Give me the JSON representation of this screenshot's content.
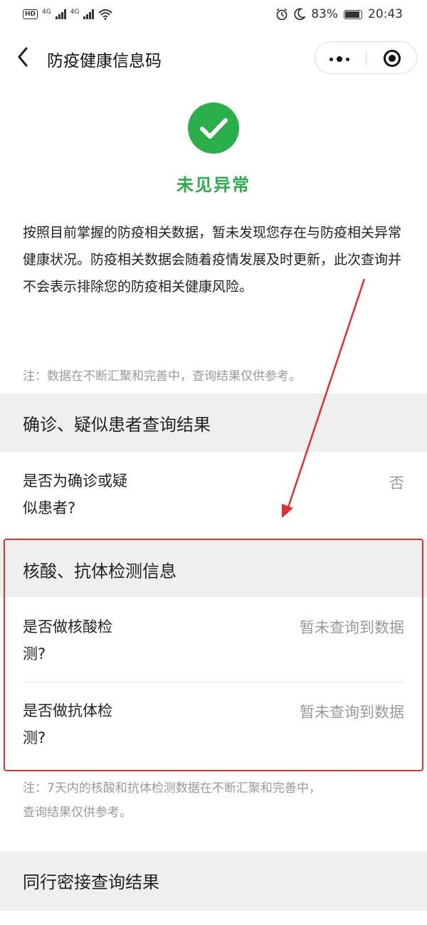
{
  "status_bar": {
    "left_badge": "HD",
    "network_1": "4G",
    "network_2": "4G",
    "battery_percent": "83%",
    "battery_level": 0.83,
    "time": "20:43",
    "icons": [
      "alarm-icon",
      "moon-icon",
      "battery-icon",
      "wifi-icon",
      "signal-icon"
    ]
  },
  "nav": {
    "back_icon": "chevron-left-icon",
    "title": "防疫健康信息码",
    "more_icon": "more-dots-icon",
    "close_icon": "target-circle-icon"
  },
  "result": {
    "icon": "check-circle-icon",
    "status": "未见异常",
    "status_color": "#2aae4a",
    "description": "按照目前掌握的防疫相关数据，暂未发现您存在与防疫相关异常健康状况。防疫相关数据会随着疫情发展及时更新，此次查询并不会表示排除您的防疫相关健康风险。",
    "note": "注：数据在不断汇聚和完善中，查询结果仅供参考。"
  },
  "section_confirmed": {
    "title": "确诊、疑似患者查询结果",
    "rows": [
      {
        "label_line1": "是否为确诊或疑",
        "label_line2": "似患者?",
        "value": "否"
      }
    ]
  },
  "section_tests": {
    "title": "核酸、抗体检测信息",
    "rows": [
      {
        "label_line1": "是否做核酸检",
        "label_line2": "测?",
        "value": "暂未查询到数据"
      },
      {
        "label_line1": "是否做抗体检",
        "label_line2": "测?",
        "value": "暂未查询到数据"
      }
    ],
    "note_line1": "注：7天内的核酸和抗体检测数据在不断汇聚和完善中，",
    "note_line2": "查询结果仅供参考。",
    "highlight_color": "#e03030"
  },
  "section_contacts": {
    "title": "同行密接查询结果"
  }
}
